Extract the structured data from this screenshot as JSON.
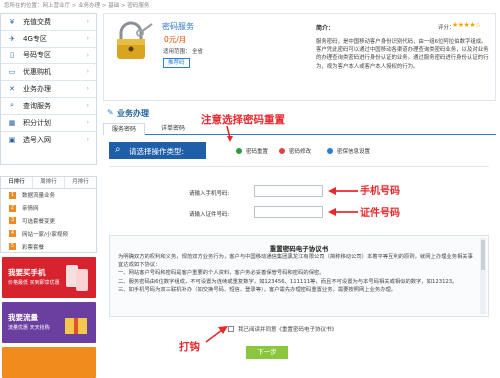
{
  "breadcrumb": "您所在的位置：网上营业厅 > 业务办理 > 基础 > 密码服务",
  "sidebar": {
    "items": [
      {
        "label": "充值交费",
        "icon": "wallet-icon"
      },
      {
        "label": "4G专区",
        "icon": "4g-icon"
      },
      {
        "label": "号码专区",
        "icon": "phone-icon"
      },
      {
        "label": "优惠购机",
        "icon": "laptop-icon"
      },
      {
        "label": "业务办理",
        "icon": "tools-icon"
      },
      {
        "label": "查询服务",
        "icon": "search-icon"
      },
      {
        "label": "积分计划",
        "icon": "calculator-icon"
      },
      {
        "label": "选号入网",
        "icon": "sim-icon"
      }
    ]
  },
  "rank": {
    "tabs": [
      "日排行",
      "周排行",
      "月排行"
    ],
    "items": [
      {
        "num": "1",
        "label": "数据流量业务"
      },
      {
        "num": "2",
        "label": "亲情网"
      },
      {
        "num": "3",
        "label": "可选套餐变更"
      },
      {
        "num": "4",
        "label": "网站一家/小家视频"
      },
      {
        "num": "5",
        "label": "彩票套餐"
      }
    ]
  },
  "banners": [
    {
      "title": "我要买手机",
      "sub": "价格最低 买到即享优惠",
      "color": "#d7232d"
    },
    {
      "title": "我要流量",
      "sub": "流量优惠 天天抢购",
      "color": "#6b3fa0"
    },
    {
      "title": "",
      "sub": "",
      "color": "#f28b1e"
    }
  ],
  "product": {
    "name": "密码服务",
    "price": "0元/月",
    "fee_label": "适用范围：",
    "fee_value": "全省",
    "recommend_label": "推荐码",
    "intro_label": "简介：",
    "rating_label": "评分：",
    "stars": "★★★★☆",
    "rating_value": 4,
    "intro_text": "服务密码，是中国移动客户身份识别代码，由一组6位阿拉伯数字组成。客户凭此密码可以通过中国移动各渠道办理查询类密码业务，以及对业务的办理查询类密码进行身份认证的业务。通过服务密码进行身份认证的行为，视为客户本人或客户本人授权的行为。"
  },
  "business": {
    "title": "业务办理",
    "tabs": [
      "服务密码",
      "详单密码"
    ]
  },
  "annotations": {
    "top": "注意选择密码重置",
    "mobile": "手机号码",
    "id": "证件号码",
    "tick": "打钩"
  },
  "operation": {
    "selector_label": "请选择操作类型:",
    "options": [
      {
        "label": "密码重置",
        "color": "#2e9a3c"
      },
      {
        "label": "密码修改",
        "color": "#d64545"
      },
      {
        "label": "密保信息设置",
        "color": "#2b7ed2"
      }
    ]
  },
  "form": {
    "mobile_label": "请输入手机号码:",
    "mobile_value": "",
    "id_label": "请输入证件号码:",
    "id_value": ""
  },
  "agreement": {
    "title": "重置密码电子协议书",
    "text": "为明确双方的权利和义务，规范双方业务行为，客户与中国移动通信集团黑龙江有限公司（简称移动公司）本着平等互利的原则，就网上办理业务相关事宜达成如下协议：\n一、网站客户号码和密码是客户重要的个人资料，客户务必妥善保管号码和密码的保密。\n二、服务密码由6位数字组成，不可设置为连续或重复数字，如123456、111111等，而且不可设置为与本号码相关或相似的数字，如123123。\n三、如手机号码为双三联机补办（如交换号码、短信、登录等），客户需先办理密码重置业务，需要按照网上业务办理。",
    "check_label": "我已阅读并同意《重置密码电子协议书》",
    "next_label": "下一步"
  }
}
